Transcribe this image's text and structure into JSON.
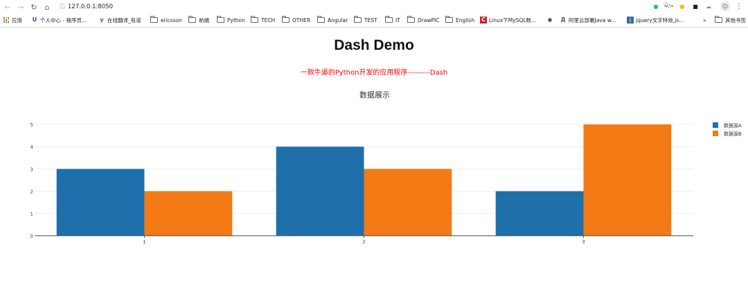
{
  "browser": {
    "url": "127.0.0.1:8050",
    "bookmarks": [
      {
        "label": "应用",
        "icon": "apps-grid-icon"
      },
      {
        "label": "个人中心 - 程序员...",
        "icon": "u-logo-icon"
      },
      {
        "label": "在线翻译_有道",
        "icon": "youdao-icon"
      },
      {
        "label": "ericsson",
        "icon": "folder-icon"
      },
      {
        "label": "前端",
        "icon": "folder-icon"
      },
      {
        "label": "Python",
        "icon": "folder-icon"
      },
      {
        "label": "TECH",
        "icon": "folder-icon"
      },
      {
        "label": "OTHER",
        "icon": "folder-icon"
      },
      {
        "label": "Angular",
        "icon": "folder-icon"
      },
      {
        "label": "TEST",
        "icon": "folder-icon"
      },
      {
        "label": "IT",
        "icon": "folder-icon"
      },
      {
        "label": "DrawPIC",
        "icon": "folder-icon"
      },
      {
        "label": "English",
        "icon": "folder-icon"
      },
      {
        "label": "Linux下MySQL数...",
        "icon": "csdn-icon"
      },
      {
        "label": "",
        "icon": "globe-icon"
      },
      {
        "label": "阿里云部署Java w...",
        "icon": "aliyun-icon"
      },
      {
        "label": "jquery文字特效,js...",
        "icon": "jquery-icon"
      }
    ],
    "overflow": "»",
    "other_bookmarks": "其他书签"
  },
  "page": {
    "title": "Dash Demo",
    "subtitle": "一款牛逼的Python开发的应用程序---------Dash"
  },
  "colors": {
    "seriesA": "#1f6faa",
    "seriesB": "#f47a16",
    "subtitle": "#ff0000"
  },
  "chart_data": {
    "type": "bar",
    "title": "数据展示",
    "categories": [
      "1",
      "2",
      "3"
    ],
    "series": [
      {
        "name": "数据源A",
        "values": [
          3,
          4,
          2
        ]
      },
      {
        "name": "数据源B",
        "values": [
          2,
          3,
          5
        ]
      }
    ],
    "ylim": [
      0,
      5
    ],
    "yticks": [
      0,
      1,
      2,
      3,
      4,
      5
    ],
    "grid": true,
    "legend": "top-right"
  }
}
